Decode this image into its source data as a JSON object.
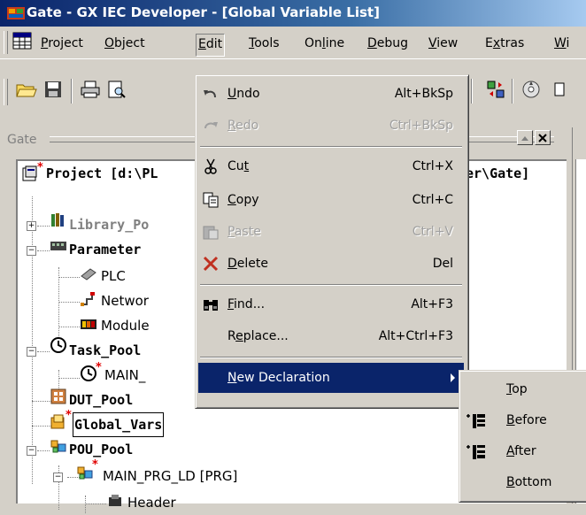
{
  "window": {
    "title": "Gate - GX IEC Developer - [Global Variable List]"
  },
  "menubar": {
    "items": [
      {
        "label": "Project",
        "u": "P",
        "rest": "roject"
      },
      {
        "label": "Object",
        "u": "O",
        "rest": "bject"
      },
      {
        "label": "Edit",
        "u": "E",
        "rest": "dit"
      },
      {
        "label": "Tools",
        "u": "T",
        "rest": "ools"
      },
      {
        "label": "Online",
        "pre": "On",
        "u": "l",
        "rest": "ine"
      },
      {
        "label": "Debug",
        "u": "D",
        "rest": "ebug"
      },
      {
        "label": "View",
        "u": "V",
        "rest": "iew"
      },
      {
        "label": "Extras",
        "pre": "E",
        "u": "x",
        "rest": "tras"
      },
      {
        "label": "Wi",
        "u": "W",
        "rest": "i"
      }
    ]
  },
  "tree_window": {
    "caption": "Gate",
    "nodes": [
      {
        "label": "Project [d:\\PL",
        "suffix": "er\\Gate]"
      },
      {
        "label": "Library_Po"
      },
      {
        "label": "Parameter"
      },
      {
        "label": "PLC"
      },
      {
        "label": "Networ"
      },
      {
        "label": "Module"
      },
      {
        "label": "Task_Pool"
      },
      {
        "label": "MAIN_"
      },
      {
        "label": "DUT_Pool"
      },
      {
        "label": "Global_Vars"
      },
      {
        "label": "POU_Pool"
      },
      {
        "label": "MAIN_PRG_LD [PRG]"
      },
      {
        "label": "Header"
      }
    ]
  },
  "edit_menu": {
    "items": [
      {
        "pre": "",
        "u": "U",
        "rest": "ndo",
        "accel": "Alt+BkSp",
        "icon": "undo-icon",
        "enabled": true
      },
      {
        "pre": "",
        "u": "R",
        "rest": "edo",
        "accel": "Ctrl+BkSp",
        "icon": "redo-icon",
        "enabled": false
      },
      {
        "pre": "Cu",
        "u": "t",
        "rest": "",
        "accel": "Ctrl+X",
        "icon": "scissors-icon",
        "enabled": true
      },
      {
        "pre": "",
        "u": "C",
        "rest": "opy",
        "accel": "Ctrl+C",
        "icon": "copy-icon",
        "enabled": true
      },
      {
        "pre": "",
        "u": "P",
        "rest": "aste",
        "accel": "Ctrl+V",
        "icon": "paste-icon",
        "enabled": false
      },
      {
        "pre": "",
        "u": "D",
        "rest": "elete",
        "accel": "Del",
        "icon": "delete-x-icon",
        "enabled": true
      },
      {
        "pre": "",
        "u": "F",
        "rest": "ind...",
        "accel": "Alt+F3",
        "icon": "binoculars-icon",
        "enabled": true
      },
      {
        "pre": "R",
        "u": "e",
        "rest": "place...",
        "accel": "Alt+Ctrl+F3",
        "icon": "",
        "enabled": true
      },
      {
        "pre": "",
        "u": "N",
        "rest": "ew Declaration",
        "accel": "",
        "icon": "",
        "enabled": true,
        "submenu": true
      }
    ]
  },
  "new_declaration_submenu": {
    "items": [
      {
        "u": "T",
        "rest": "op",
        "icon": ""
      },
      {
        "u": "B",
        "rest": "efore",
        "icon": "insert-before-icon"
      },
      {
        "u": "A",
        "rest": "fter",
        "icon": "insert-after-icon"
      },
      {
        "u": "B",
        "rest": "ottom",
        "icon": ""
      }
    ]
  },
  "colors": {
    "titlebar_start": "#0a246a",
    "titlebar_end": "#a6caf0",
    "menu_highlight": "#0a246a",
    "face": "#d4d0c8"
  }
}
